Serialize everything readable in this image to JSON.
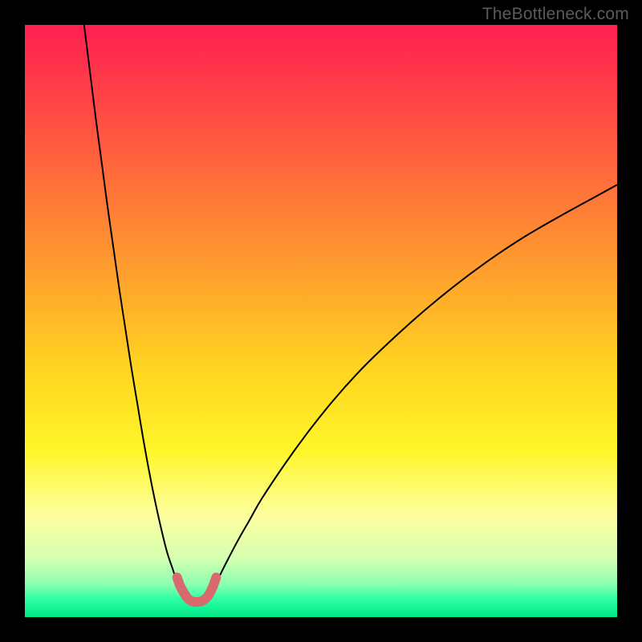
{
  "watermark": "TheBottleneck.com",
  "chart_data": {
    "type": "line",
    "title": "",
    "xlabel": "",
    "ylabel": "",
    "xlim": [
      0,
      100
    ],
    "ylim": [
      0,
      100
    ],
    "grid": false,
    "legend": false,
    "background_gradient": {
      "stops": [
        {
          "offset": 0.0,
          "color": "#ff1f52"
        },
        {
          "offset": 0.2,
          "color": "#ff5a3f"
        },
        {
          "offset": 0.4,
          "color": "#ff9a2f"
        },
        {
          "offset": 0.58,
          "color": "#ffd420"
        },
        {
          "offset": 0.72,
          "color": "#fff62a"
        },
        {
          "offset": 0.83,
          "color": "#fdffa0"
        },
        {
          "offset": 0.9,
          "color": "#d6ffb0"
        },
        {
          "offset": 0.945,
          "color": "#8affb0"
        },
        {
          "offset": 0.97,
          "color": "#2bffa4"
        },
        {
          "offset": 1.0,
          "color": "#00e989"
        }
      ]
    },
    "series": [
      {
        "name": "left-branch",
        "stroke": "#000000",
        "weight": 2,
        "x": [
          10,
          11,
          12,
          13,
          14,
          15,
          16,
          17,
          18,
          19,
          20,
          21,
          22,
          23,
          24,
          25,
          25.5,
          26,
          26.5
        ],
        "y": [
          100,
          92,
          84,
          76.5,
          69,
          62,
          55,
          48.5,
          42,
          36,
          30,
          24.5,
          19.5,
          15,
          11,
          8,
          6.5,
          5.3,
          4.3
        ]
      },
      {
        "name": "right-branch",
        "stroke": "#000000",
        "weight": 2,
        "x": [
          31.5,
          32,
          33,
          34,
          36,
          38,
          40,
          44,
          48,
          52,
          56,
          60,
          66,
          72,
          78,
          84,
          90,
          96,
          100
        ],
        "y": [
          4.3,
          5.2,
          7.2,
          9.2,
          13,
          16.5,
          20,
          26,
          31.5,
          36.5,
          41,
          45,
          50.5,
          55.5,
          60,
          64,
          67.5,
          70.8,
          73
        ]
      },
      {
        "name": "valley-marker",
        "stroke": "#d86a6e",
        "weight": 12,
        "linecap": "round",
        "x": [
          25.7,
          26.2,
          26.8,
          27.3,
          27.8,
          28.5,
          29.5,
          30.2,
          30.8,
          31.3,
          31.8,
          32.3
        ],
        "y": [
          6.7,
          5.3,
          4.2,
          3.4,
          2.9,
          2.6,
          2.6,
          2.9,
          3.4,
          4.2,
          5.3,
          6.7
        ]
      }
    ]
  }
}
